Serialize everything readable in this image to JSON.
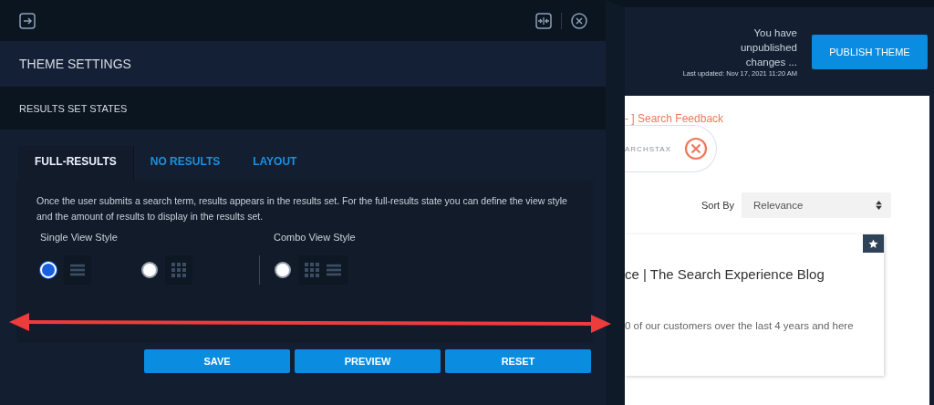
{
  "panel": {
    "title": "THEME SETTINGS",
    "section": "RESULTS SET STATES",
    "tabs": [
      {
        "label": "FULL-RESULTS",
        "selected": true
      },
      {
        "label": "NO RESULTS",
        "selected": false
      },
      {
        "label": "LAYOUT",
        "selected": false
      }
    ],
    "description": "Once the user submits a search term, results appears in the results set. For the full-results state you can define the view style and the amount of results to display in the results set.",
    "view_styles": [
      {
        "label": "Single View Style",
        "options": [
          {
            "selected": true,
            "kind": "list"
          },
          {
            "selected": false,
            "kind": "grid"
          }
        ]
      },
      {
        "label": "Combo View Style",
        "options": [
          {
            "selected": false,
            "kind": "combo"
          }
        ]
      }
    ],
    "buttons": [
      "SAVE",
      "PREVIEW",
      "RESET"
    ]
  },
  "header": {
    "status": "You have unpublished changes ...",
    "updated": "Last updated: Nov 17, 2021 11:20 AM",
    "publish": "PUBLISH THEME"
  },
  "preview": {
    "feedback": "- ] Search Feedback",
    "logo_text": "ARCHSTAX",
    "sort_label": "Sort By",
    "sort_value": "Relevance",
    "result": {
      "title": "ce | The Search Experience Blog",
      "snippet": "0 of our customers over the last 4 years and here"
    }
  }
}
